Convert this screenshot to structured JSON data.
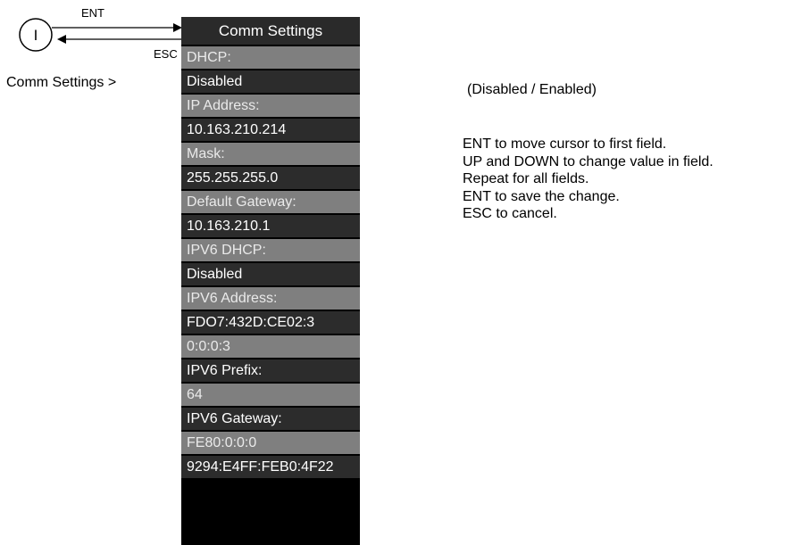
{
  "nav": {
    "ent_label": "ENT",
    "esc_label": "ESC",
    "info_icon_glyph": "I",
    "menu_path": "Comm Settings >"
  },
  "screen": {
    "title": "Comm Settings",
    "rows": [
      {
        "type": "label",
        "text": "DHCP:"
      },
      {
        "type": "value",
        "text": "Disabled"
      },
      {
        "type": "label",
        "text": "IP Address:"
      },
      {
        "type": "value",
        "text": "10.163.210.214"
      },
      {
        "type": "label",
        "text": "Mask:"
      },
      {
        "type": "value",
        "text": "255.255.255.0"
      },
      {
        "type": "label",
        "text": "Default Gateway:"
      },
      {
        "type": "value",
        "text": "10.163.210.1"
      },
      {
        "type": "label",
        "text": "IPV6 DHCP:"
      },
      {
        "type": "value",
        "text": "Disabled"
      },
      {
        "type": "label",
        "text": "IPV6 Address:"
      },
      {
        "type": "value",
        "text": "FDO7:432D:CE02:3"
      },
      {
        "type": "label",
        "text": "0:0:0:3"
      },
      {
        "type": "value",
        "text": "IPV6 Prefix:"
      },
      {
        "type": "label",
        "text": "64"
      },
      {
        "type": "value",
        "text": "IPV6 Gateway:"
      },
      {
        "type": "label",
        "text": "FE80:0:0:0"
      },
      {
        "type": "value",
        "text": "9294:E4FF:FEB0:4F22"
      }
    ]
  },
  "hints": {
    "options": "(Disabled / Enabled)",
    "instructions": [
      "ENT to move cursor to first field.",
      "UP and DOWN to change value in field.",
      "Repeat for all fields.",
      "ENT to save the change.",
      "ESC to cancel."
    ]
  }
}
